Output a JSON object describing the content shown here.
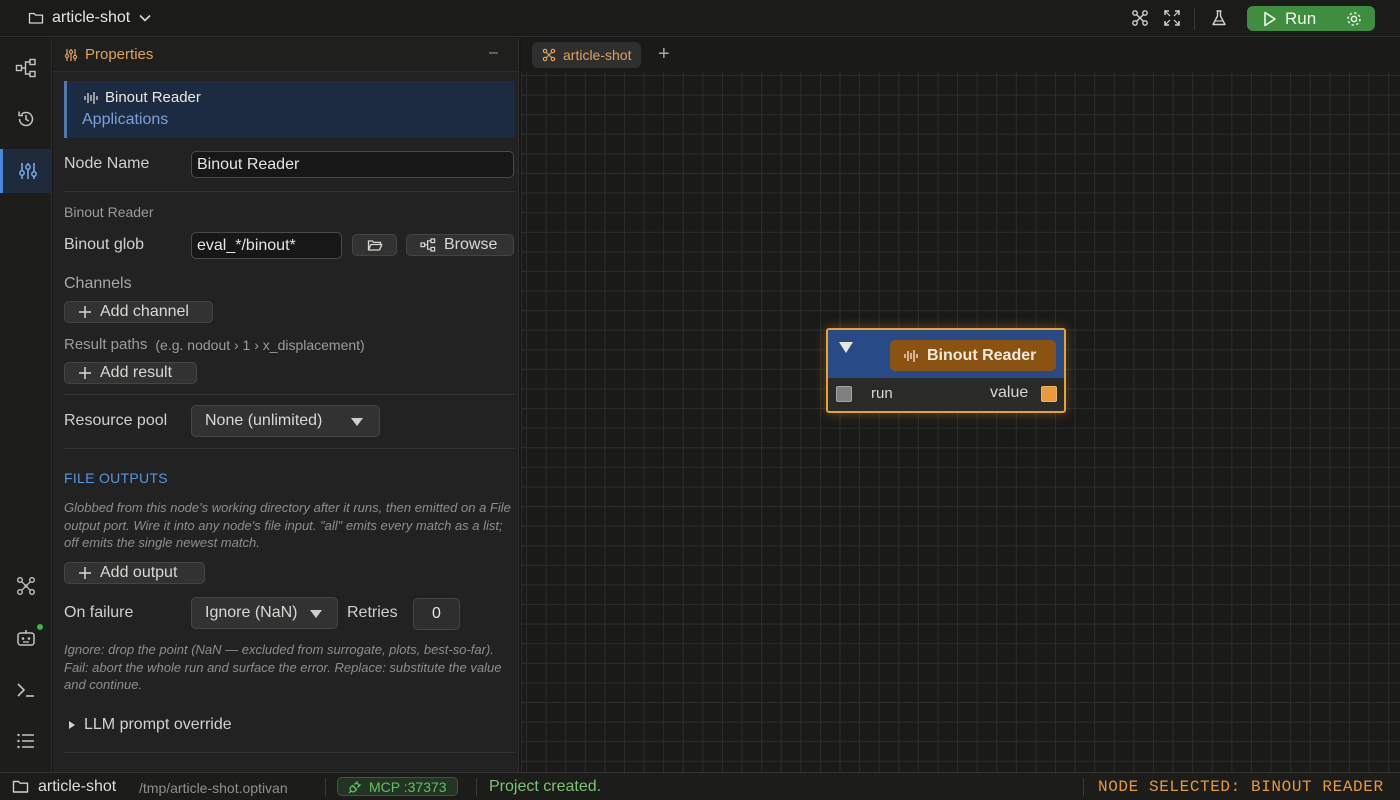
{
  "topbar": {
    "project_name": "article-shot",
    "icons": [
      "folder-icon",
      "chevron-down-icon",
      "graph-icon",
      "fullscreen-icon",
      "flask-icon",
      "play-icon",
      "gear-icon"
    ],
    "run_label": "Run",
    "run_color": "#3f8d3e"
  },
  "rail": {
    "items": [
      "workflow-icon",
      "history-icon",
      "properties-icon",
      "graph-icon",
      "robot-icon",
      "terminal-icon",
      "list-icon"
    ],
    "active": "properties-icon"
  },
  "properties": {
    "title": "Properties",
    "collapse_label": "–",
    "node_card": {
      "title": "Binout Reader",
      "category": "Applications"
    },
    "node_name_label": "Node Name",
    "node_name_value": "Binout Reader",
    "section_title": "Binout Reader",
    "binout_glob_label": "Binout glob",
    "binout_glob_value": "eval_*/binout*",
    "browse_label": "Browse",
    "channels_label": "Channels",
    "add_channel_label": "Add channel",
    "result_paths_label": "Result paths",
    "result_paths_hint": "(e.g. nodout › 1 › x_displacement)",
    "add_result_label": "Add result",
    "resource_pool_label": "Resource pool",
    "resource_pool_value": "None (unlimited)",
    "file_outputs_title": "FILE OUTPUTS",
    "file_outputs_help": "Globbed from this node's working directory after it runs, then emitted on a File output port. Wire it into any node's file input. \"all\" emits every match as a list; off emits the single newest match.",
    "add_output_label": "Add output",
    "on_failure_label": "On failure",
    "on_failure_value": "Ignore (NaN)",
    "retries_label": "Retries",
    "retries_value": "0",
    "failure_help": "Ignore: drop the point (NaN — excluded from surrogate, plots, best-so-far).  Fail: abort the whole run and surface the error.  Replace: substitute the value and continue.",
    "llm_override_label": "LLM prompt override"
  },
  "canvas": {
    "tab_label": "article-shot",
    "tab_add_label": "+",
    "node": {
      "title": "Binout Reader",
      "input_port": "run",
      "output_port": "value",
      "header_color": "#284a86",
      "accent_color": "#e9a136"
    }
  },
  "statusbar": {
    "project": "article-shot",
    "path": "/tmp/article-shot.optivan",
    "mcp_label": "MCP :37373",
    "message": "Project created.",
    "selection": "NODE SELECTED: BINOUT READER"
  }
}
